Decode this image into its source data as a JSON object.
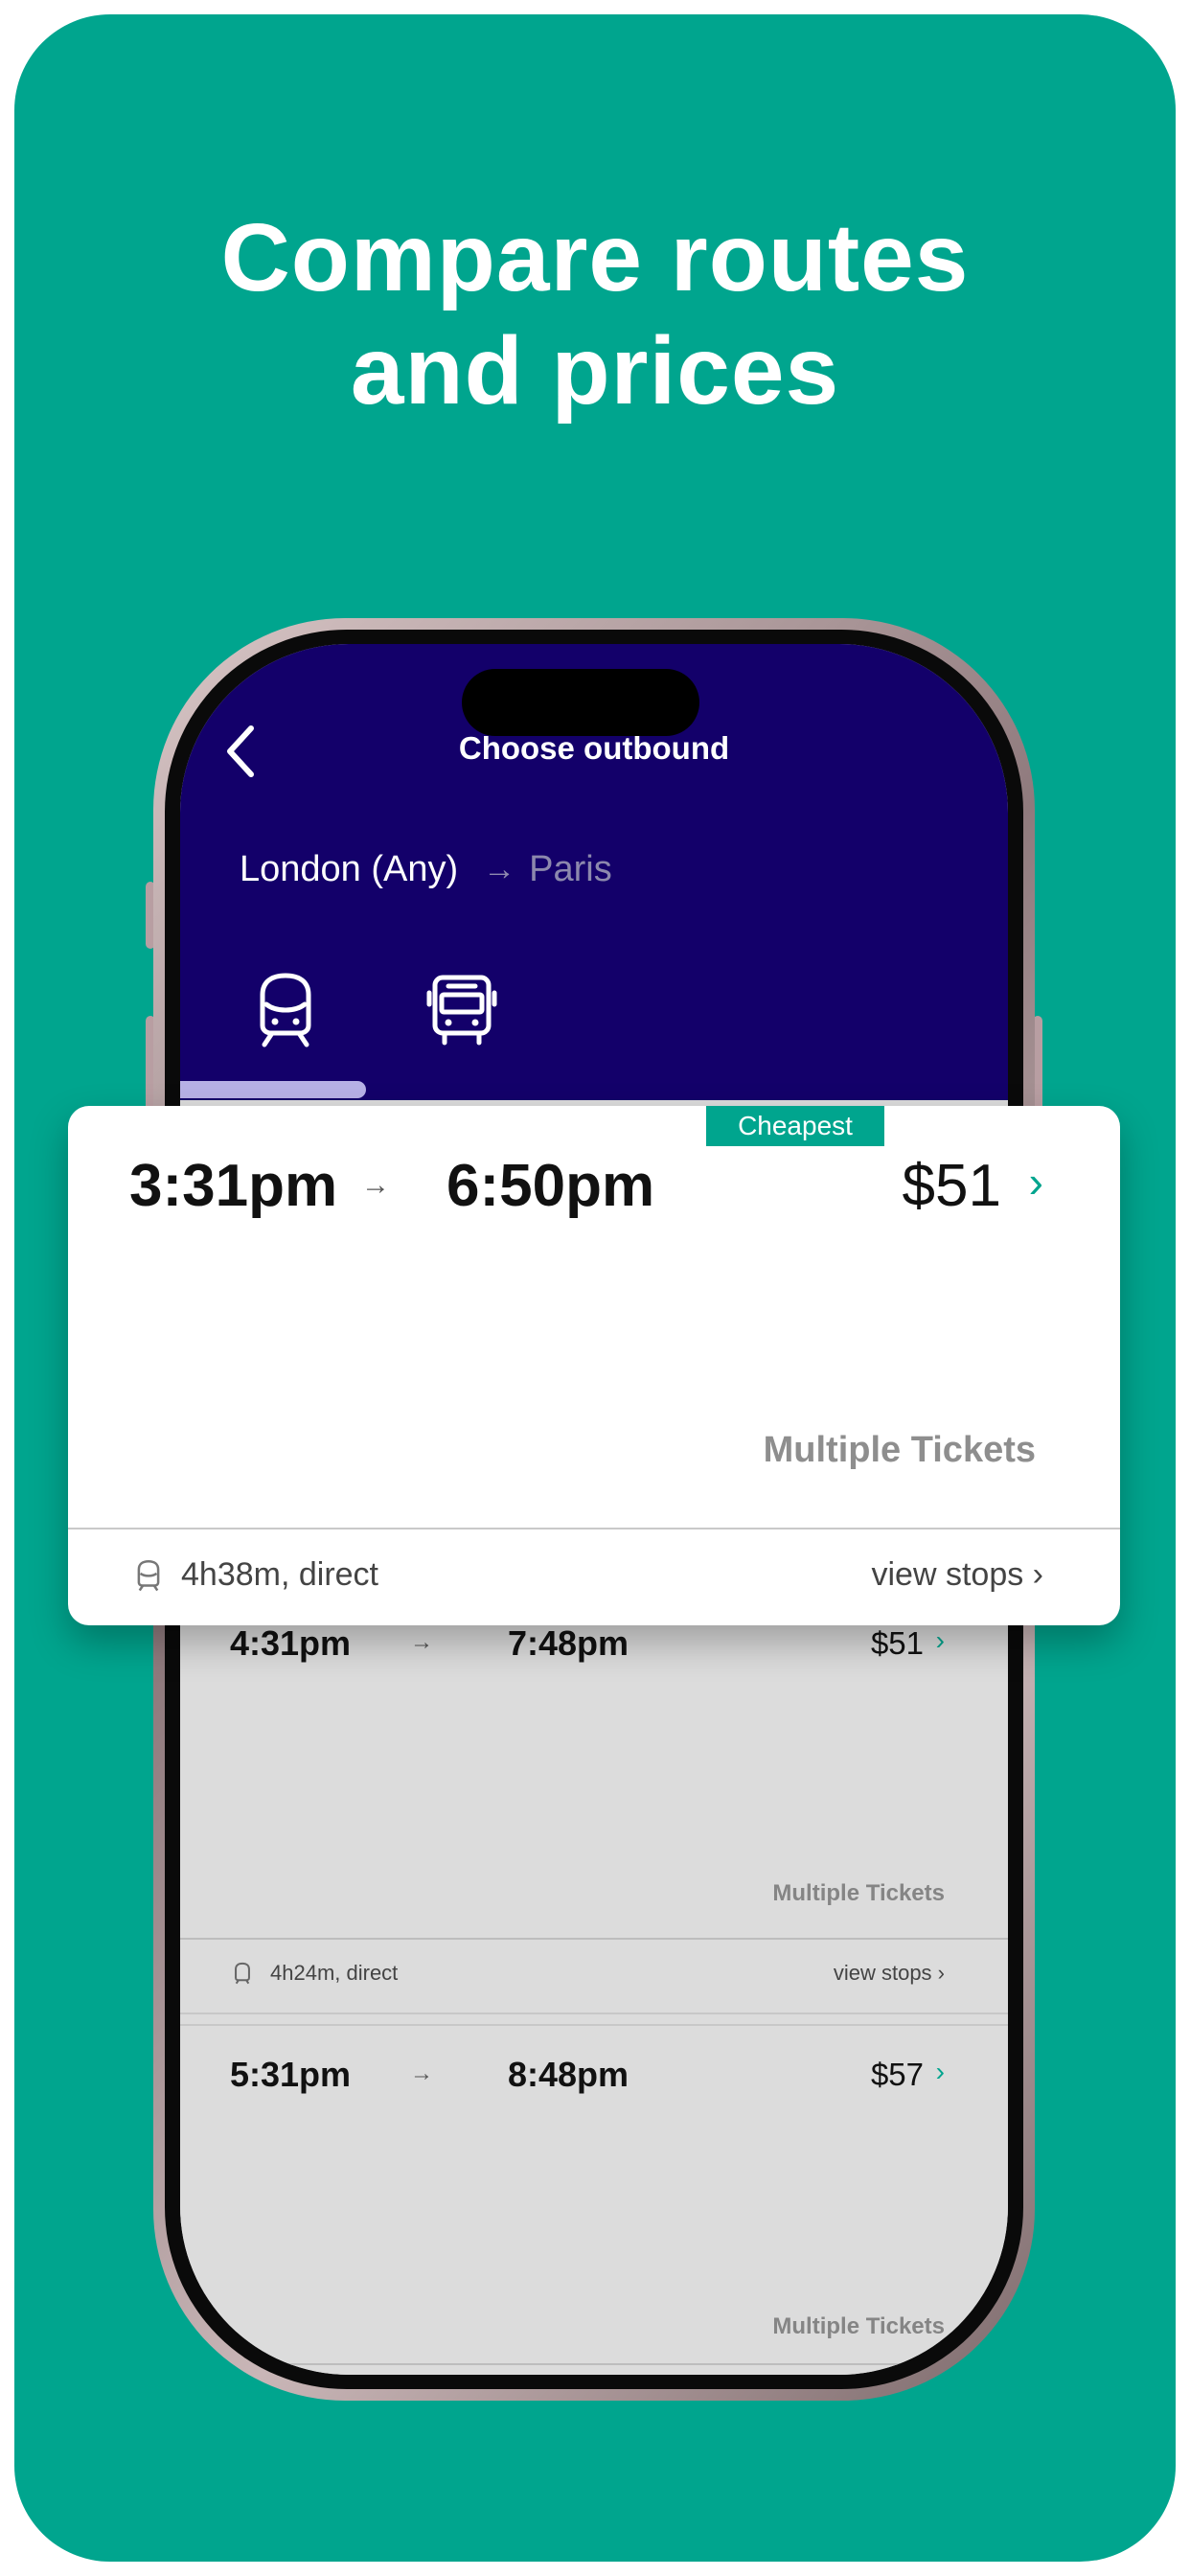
{
  "promo": {
    "headline_line1": "Compare routes",
    "headline_line2": "and prices"
  },
  "colors": {
    "brand_green": "#00a58e",
    "header_navy": "#13006a",
    "tab_underline": "#b7b1e6"
  },
  "screen": {
    "title": "Choose outbound",
    "route": {
      "origin": "London (Any)",
      "arrow": "→",
      "destination": "Paris"
    },
    "modes": [
      "train-icon",
      "bus-icon"
    ]
  },
  "featured": {
    "badge": "Cheapest",
    "depart": "3:31pm",
    "arrow": "→",
    "arrive": "6:50pm",
    "price": "$51",
    "chevron": "›",
    "tickets": "Multiple Tickets",
    "duration": "4h38m, direct",
    "view_stops": "view stops ›"
  },
  "results": [
    {
      "depart": "4:31pm",
      "arrow": "→",
      "arrive": "7:48pm",
      "price": "$51",
      "chevron": "›",
      "tickets": "Multiple Tickets",
      "duration": "4h24m, direct",
      "view_stops": "view stops ›"
    },
    {
      "depart": "5:31pm",
      "arrow": "→",
      "arrive": "8:48pm",
      "price": "$57",
      "chevron": "›",
      "tickets": "Multiple Tickets"
    }
  ]
}
